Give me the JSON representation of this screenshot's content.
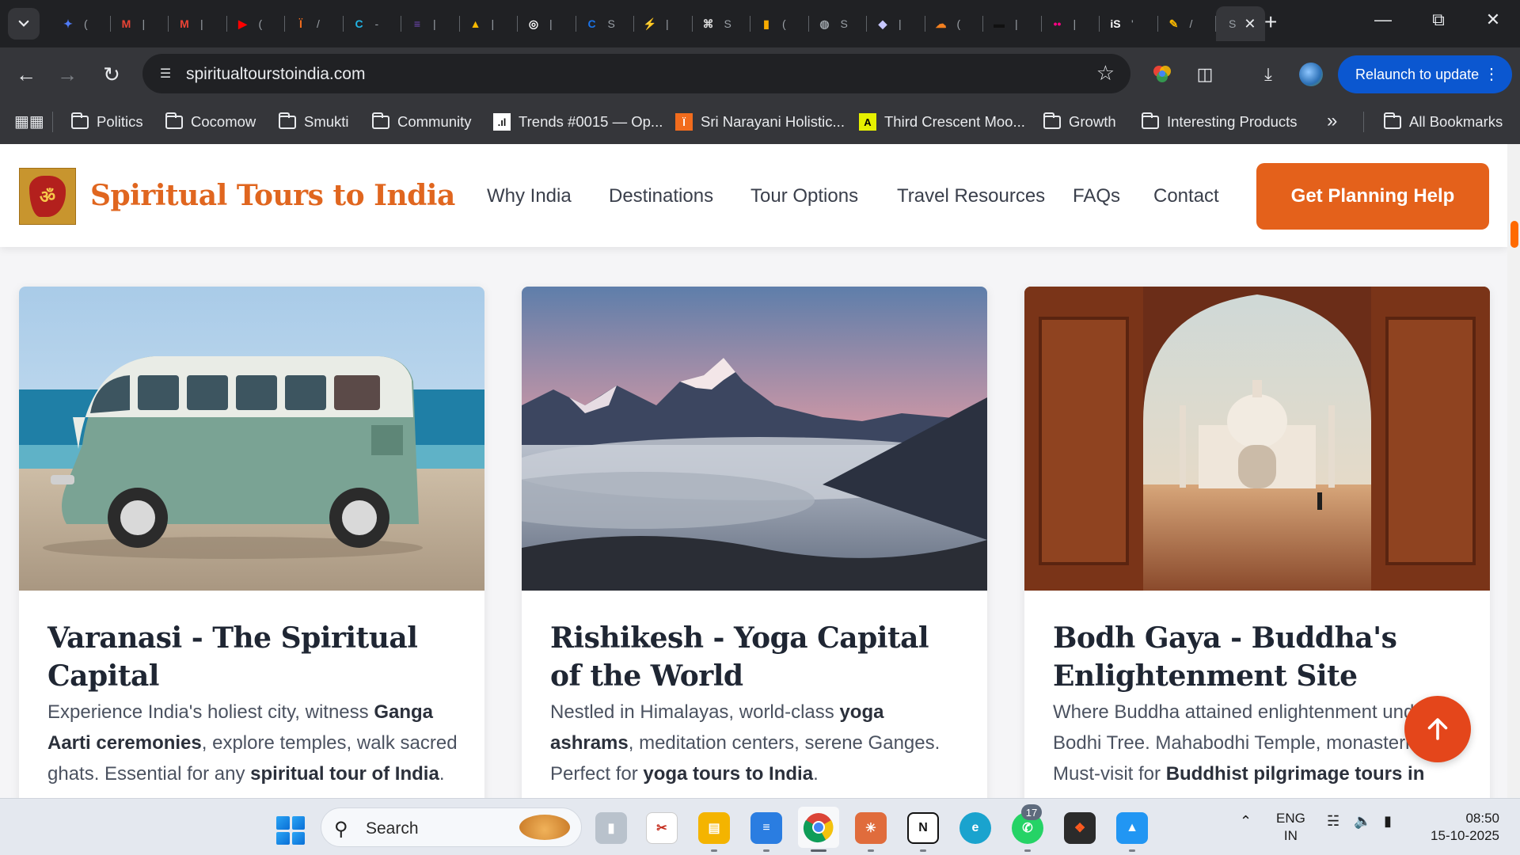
{
  "browser": {
    "tab_search_icon": "chevron-down",
    "tabs": [
      {
        "icon": "gemini-sparkle",
        "color": "#4f7bf7",
        "glyph": "✦",
        "tick": "("
      },
      {
        "icon": "gmail",
        "color": "#ea4335",
        "glyph": "M",
        "tick": "|"
      },
      {
        "icon": "gmail",
        "color": "#ea4335",
        "glyph": "M",
        "tick": "|"
      },
      {
        "icon": "youtube",
        "color": "#ff0000",
        "glyph": "▶",
        "tick": "("
      },
      {
        "icon": "sri-narayani",
        "color": "#f26c1d",
        "glyph": "Ï",
        "tick": "/"
      },
      {
        "icon": "canva",
        "color": "#22b5e5",
        "glyph": "C",
        "tick": "-"
      },
      {
        "icon": "forms",
        "color": "#7248b9",
        "glyph": "≡",
        "tick": "|"
      },
      {
        "icon": "google-drive",
        "color": "#f7b900",
        "glyph": "▲",
        "tick": "|"
      },
      {
        "icon": "circle-app",
        "color": "#ffffff",
        "glyph": "◎",
        "tick": "|"
      },
      {
        "icon": "c-app",
        "color": "#1a73e8",
        "glyph": "C",
        "tick": "S"
      },
      {
        "icon": "bolt-app",
        "color": "#1ea362",
        "glyph": "⚡",
        "tick": "|"
      },
      {
        "icon": "openai",
        "color": "#d8d8d8",
        "glyph": "⌘",
        "tick": "S"
      },
      {
        "icon": "analytics",
        "color": "#f9ab00",
        "glyph": "▮",
        "tick": "("
      },
      {
        "icon": "globe",
        "color": "#9aa0a6",
        "glyph": "◍",
        "tick": "S"
      },
      {
        "icon": "diamond-app",
        "color": "#c8c8ff",
        "glyph": "◆",
        "tick": "|"
      },
      {
        "icon": "cloudflare",
        "color": "#f38020",
        "glyph": "☁",
        "tick": "("
      },
      {
        "icon": "dark-app",
        "color": "#111111",
        "glyph": "▬",
        "tick": "|"
      },
      {
        "icon": "flickr",
        "color": "#ff0084",
        "glyph": "••",
        "tick": "|"
      },
      {
        "icon": "is-app",
        "color": "#ffffff",
        "glyph": "iS",
        "tick": "'"
      },
      {
        "icon": "pen-app",
        "color": "#f4b400",
        "glyph": "✎",
        "tick": "/"
      }
    ],
    "active_tab_tick": "S",
    "url": "spiritualtourstoindia.com",
    "relaunch_label": "Relaunch to update",
    "bookmarks": [
      {
        "label": "Politics",
        "type": "folder"
      },
      {
        "label": "Cocomow",
        "type": "folder"
      },
      {
        "label": "Smukti",
        "type": "folder"
      },
      {
        "label": "Community",
        "type": "folder"
      },
      {
        "label": "Trends #0015 — Op...",
        "type": "site",
        "glyph": ".ıl",
        "color": "#ffffff"
      },
      {
        "label": "Sri Narayani Holistic...",
        "type": "site",
        "glyph": "Ï",
        "color": "#f26c1d"
      },
      {
        "label": "Third Crescent Moo...",
        "type": "site",
        "glyph": "A",
        "color": "#e6f000"
      },
      {
        "label": "Growth",
        "type": "folder"
      },
      {
        "label": "Interesting Products",
        "type": "folder"
      }
    ],
    "all_bookmarks_label": "All Bookmarks"
  },
  "site": {
    "logo_glyph": "ॐ",
    "title": "Spiritual Tours to India",
    "nav": [
      "Why India",
      "Destinations",
      "Tour Options",
      "Travel Resources",
      "FAQs",
      "Contact"
    ],
    "cta_label": "Get Planning Help",
    "back_to_top_icon": "arrow-up",
    "cards": [
      {
        "image": "vintage green van on a beach",
        "title": "Varanasi - The Spiritual Capital",
        "text_parts": [
          {
            "t": "Experience India's holiest city, witness ",
            "b": false
          },
          {
            "t": "Ganga Aarti ceremonies",
            "b": true
          },
          {
            "t": ", explore temples, walk sacred ghats. Essential for any ",
            "b": false
          },
          {
            "t": "spiritual tour of India",
            "b": true
          },
          {
            "t": ".",
            "b": false
          }
        ]
      },
      {
        "image": "Himalayan peaks above a sea of clouds at sunset",
        "title": "Rishikesh - Yoga Capital of the World",
        "text_parts": [
          {
            "t": "Nestled in Himalayas, world-class ",
            "b": false
          },
          {
            "t": "yoga ashrams",
            "b": true
          },
          {
            "t": ", meditation centers, serene Ganges. Perfect for ",
            "b": false
          },
          {
            "t": "yoga tours to India",
            "b": true
          },
          {
            "t": ".",
            "b": false
          }
        ]
      },
      {
        "image": "Taj Mahal framed by a carved red sandstone archway",
        "title": "Bodh Gaya - Buddha's Enlightenment Site",
        "text_parts": [
          {
            "t": "Where Buddha attained enlightenment under Bodhi Tree. Mahabodhi Temple, monasteries. Must-visit for ",
            "b": false
          },
          {
            "t": "Buddhist pilgrimage tours in",
            "b": true
          }
        ]
      }
    ]
  },
  "taskbar": {
    "search_label": "Search",
    "whatsapp_badge": "17",
    "lang_line1": "ENG",
    "lang_line2": "IN",
    "time": "08:50",
    "date": "15-10-2025"
  },
  "colors": {
    "brand_orange": "#e4611b",
    "chrome_dark": "#202124",
    "chrome_toolbar": "#35363a",
    "relaunch_blue": "#0b57d0"
  }
}
